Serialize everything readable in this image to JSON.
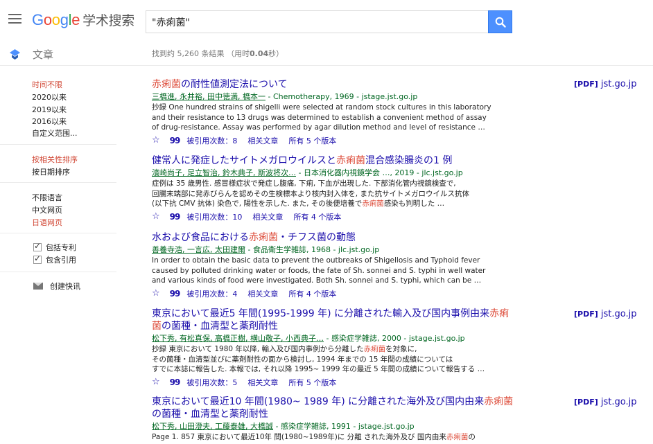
{
  "header": {
    "logo_sub": "学术搜索",
    "search_value": "\"赤痢菌\""
  },
  "subbar": {
    "section_label": "文章",
    "stats_prefix": "找到约 5,260 条结果 （用时",
    "stats_time": "0.04",
    "stats_suffix": "秒）"
  },
  "sidebar": {
    "time_filters": [
      "时间不限",
      "2020以来",
      "2019以来",
      "2016以来",
      "自定义范围..."
    ],
    "sort_options": [
      "按相关性排序",
      "按日期排序"
    ],
    "language_options": [
      "不限语言",
      "中文网页",
      "日语网页"
    ],
    "include_patents": "包括专利",
    "include_citations": "包含引用",
    "create_alert": "创建快讯"
  },
  "results": [
    {
      "title_hl": "赤痢菌",
      "title_rest": "の耐性値測定法について",
      "meta_authors": "三橋進, 永井裕, 田中徳満, 橋本一",
      "meta_source": " - Chemotherapy, 1969 - jstage.jst.go.jp",
      "snippet_1": "抄録 One hundred strains of shigelli were selected at random stock cultures in this laboratory",
      "snippet_2": "and their resistance to 13 drugs was determined to establish a convenient method of assay",
      "snippet_3": "of drug-resistance. Assay was performed by agar dilution method and level of resistance …",
      "cited_by": "被引用次数：8",
      "related": "相关文章",
      "versions": "所有 5 个版本",
      "pdf_tag": "[PDF]",
      "pdf_domain": " jst.go.jp"
    },
    {
      "title_pre": "健常人に発症したサイトメガロウイルスと",
      "title_hl": "赤痢菌",
      "title_post": "混合感染腸炎の1 例",
      "meta_authors": "濱崎尚子, 足立智治, 鈴木典子, 斯波将次…",
      "meta_source": " - 日本消化器内視鏡学会 …, 2019 - jlc.jst.go.jp",
      "snippet_1": "症例は 35 歳男性. 感冒様症状で発症し腹痛, 下痢, 下血が出現した. 下部消化管内視鏡検査で,",
      "snippet_2": "回腸末端部に発赤びらんを認めその生検標本より核内封入体を, また抗サイトメガロウイルス抗体",
      "snippet_3_pre": "(以下抗 CMV 抗体) 染色で, 陽性を示した. また, その後便培養で",
      "snippet_3_hl": "赤痢菌",
      "snippet_3_post": "感染も判明した …",
      "cited_by": "被引用次数：10",
      "related": "相关文章",
      "versions": "所有 4 个版本"
    },
    {
      "title_pre": "水および食品における",
      "title_hl": "赤痢菌",
      "title_post": "・チフス菌の動態",
      "meta_authors": "善養寺浩, 一言広, 太田建爾",
      "meta_source": " - 食品衛生学雑誌, 1968 - jlc.jst.go.jp",
      "snippet_1": "In order to obtain the basic data to prevent the outbreaks of Shigellosis and Typhoid fever",
      "snippet_2": "caused by polluted drinking water or foods, the fate of Sh. sonnei and S. typhi in well water",
      "snippet_3": "and various kinds of food were investigated. Both Sh. sonnei and S. typhi, which can be …",
      "cited_by": "被引用次数：4",
      "related": "相关文章",
      "versions": "所有 4 个版本"
    },
    {
      "title_line1_pre": "東京において最近5 年間(1995-1999 年) に分離された輸入及び国内事例由来",
      "title_line1_hl": "赤痢",
      "title_line2_hl": "菌",
      "title_line2_post": "の菌種・血清型と薬剤耐性",
      "meta_authors": "松下秀, 有松真保, 高橋正樹, 横山敬子, 小西典子…",
      "meta_source": " - 感染症学雑誌, 2000 - jstage.jst.go.jp",
      "snippet_1_pre": "抄録 東京において 1980 年以降, 輸入及び国内事例から分離した",
      "snippet_1_hl": "赤痢菌",
      "snippet_1_post": "を対象に,",
      "snippet_2": "その菌種・血清型並びに薬剤耐性の面から検討し, 1994 年までの 15 年間の成績については",
      "snippet_3": "すでに本誌に報告した. 本報では, それ以降 1995~ 1999 年の最近 5 年間の成績について報告する …",
      "cited_by": "被引用次数：5",
      "related": "相关文章",
      "versions": "所有 5 个版本",
      "pdf_tag": "[PDF]",
      "pdf_domain": " jst.go.jp"
    },
    {
      "title_line1_pre": "東京において最近10 年間(1980~ 1989 年) に分離された海外及び国内由来",
      "title_line1_hl": "赤痢菌",
      "title_line2": "の菌種・血清型と薬剤耐性",
      "meta_authors": "松下秀, 山田澄夫, 工藤泰雄, 大橋誠",
      "meta_source": " - 感染症学雑誌, 1991 - jstage.jst.go.jp",
      "snippet_1_pre": "Page 1. 857 東京において最近10年 間(1980~1989年)に 分離 された海外及び 国内由来",
      "snippet_1_hl": "赤痢菌",
      "snippet_1_post": "の",
      "pdf_tag": "[PDF]",
      "pdf_domain": " jst.go.jp"
    }
  ]
}
